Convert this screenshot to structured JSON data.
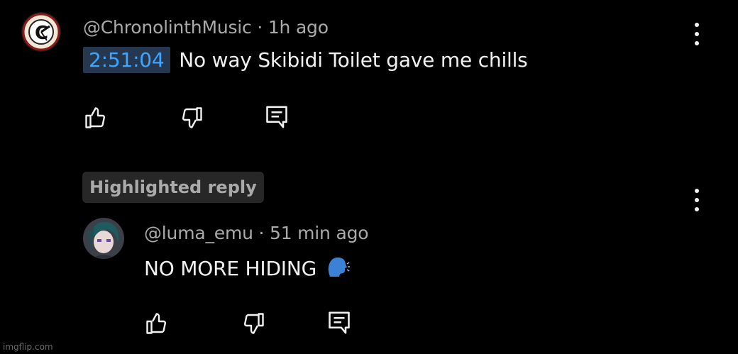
{
  "comment": {
    "author": "@ChronolinthMusic",
    "separator": "·",
    "time": "1h ago",
    "timestamp_link": "2:51:04",
    "text": "No way Skibidi Toilet gave me chills"
  },
  "highlight_badge": "Highlighted reply",
  "reply": {
    "author": "@luma_emu",
    "separator": "·",
    "time": "51 min ago",
    "text": "NO MORE HIDING",
    "emoji": "🗣"
  },
  "watermark": "imgflip.com",
  "icons": {
    "like": "thumbs-up-icon",
    "dislike": "thumbs-down-icon",
    "reply": "reply-comment-icon",
    "more": "more-vert-icon"
  },
  "colors": {
    "background": "#000000",
    "timestamp_bg": "#263850",
    "timestamp_fg": "#3ea6ff",
    "meta": "#aaaaaa",
    "text": "#f1f1f1",
    "badge_bg": "#272727"
  }
}
